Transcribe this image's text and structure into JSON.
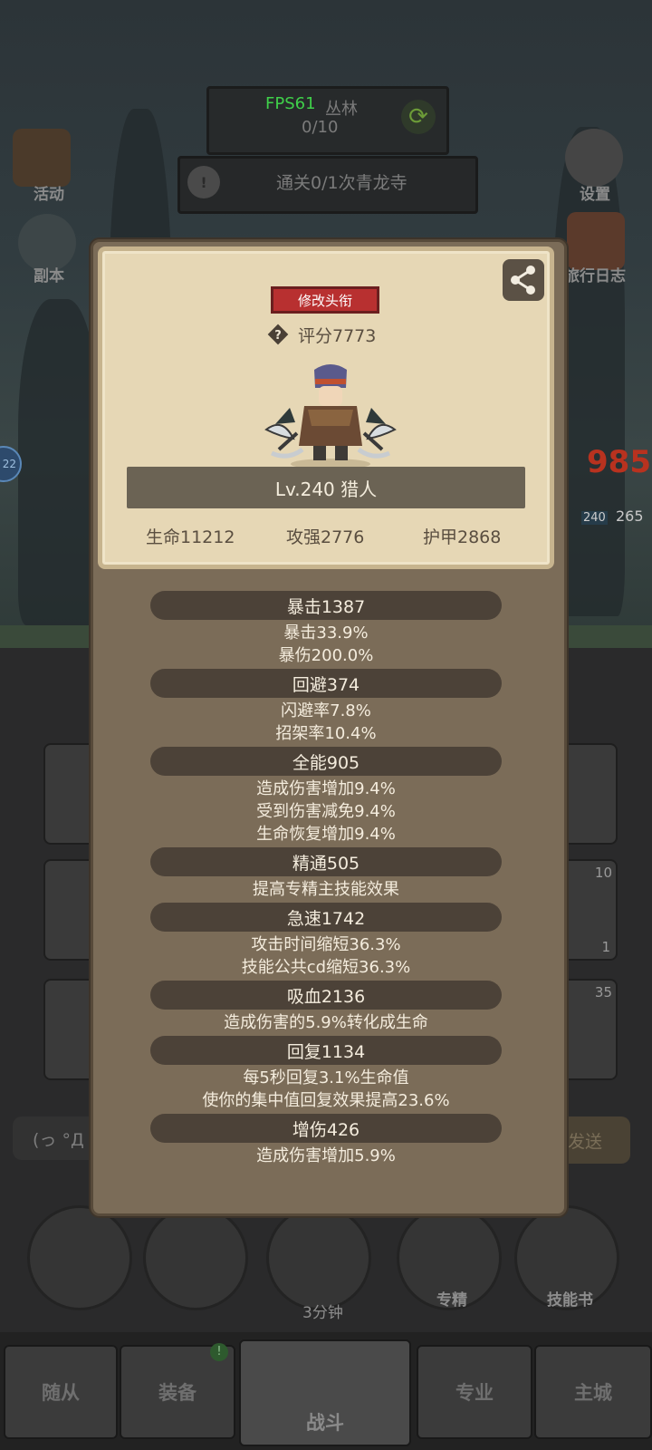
{
  "hud": {
    "fps": "FPS61",
    "area_name": "丛林",
    "progress": "0/10",
    "task": "通关0/1次青龙寺",
    "left_icons": [
      "活动",
      "副本"
    ],
    "right_icons": [
      "设置",
      "旅行日志"
    ],
    "side_badge": "22",
    "damage_number": "985",
    "enemy_level": "240",
    "enemy_hp": "265"
  },
  "bottom": {
    "chat_text": "(っ °Д °",
    "send_label": "发送",
    "chest_timer": "3分钟",
    "actions": [
      "专精",
      "技能书"
    ],
    "slot_counts": [
      "10",
      "1",
      "35"
    ],
    "nav": [
      "随从",
      "装备",
      "战斗",
      "专业",
      "主城"
    ]
  },
  "profile": {
    "title_button": "修改头衔",
    "score": "评分7773",
    "level": "Lv.240 猎人",
    "hp": "生命11212",
    "attack": "攻强2776",
    "armor": "护甲2868"
  },
  "stats": [
    {
      "head": "暴击1387",
      "lines": [
        "暴击33.9%",
        "暴伤200.0%"
      ]
    },
    {
      "head": "回避374",
      "lines": [
        "闪避率7.8%",
        "招架率10.4%"
      ]
    },
    {
      "head": "全能905",
      "lines": [
        "造成伤害增加9.4%",
        "受到伤害减免9.4%",
        "生命恢复增加9.4%"
      ]
    },
    {
      "head": "精通505",
      "lines": [
        "提高专精主技能效果"
      ]
    },
    {
      "head": "急速1742",
      "lines": [
        "攻击时间缩短36.3%",
        "技能公共cd缩短36.3%"
      ]
    },
    {
      "head": "吸血2136",
      "lines": [
        "造成伤害的5.9%转化成生命"
      ]
    },
    {
      "head": "回复1134",
      "lines": [
        "每5秒回复3.1%生命值",
        "使你的集中值回复效果提高23.6%"
      ]
    },
    {
      "head": "增伤426",
      "lines": [
        "造成伤害增加5.9%"
      ]
    }
  ]
}
